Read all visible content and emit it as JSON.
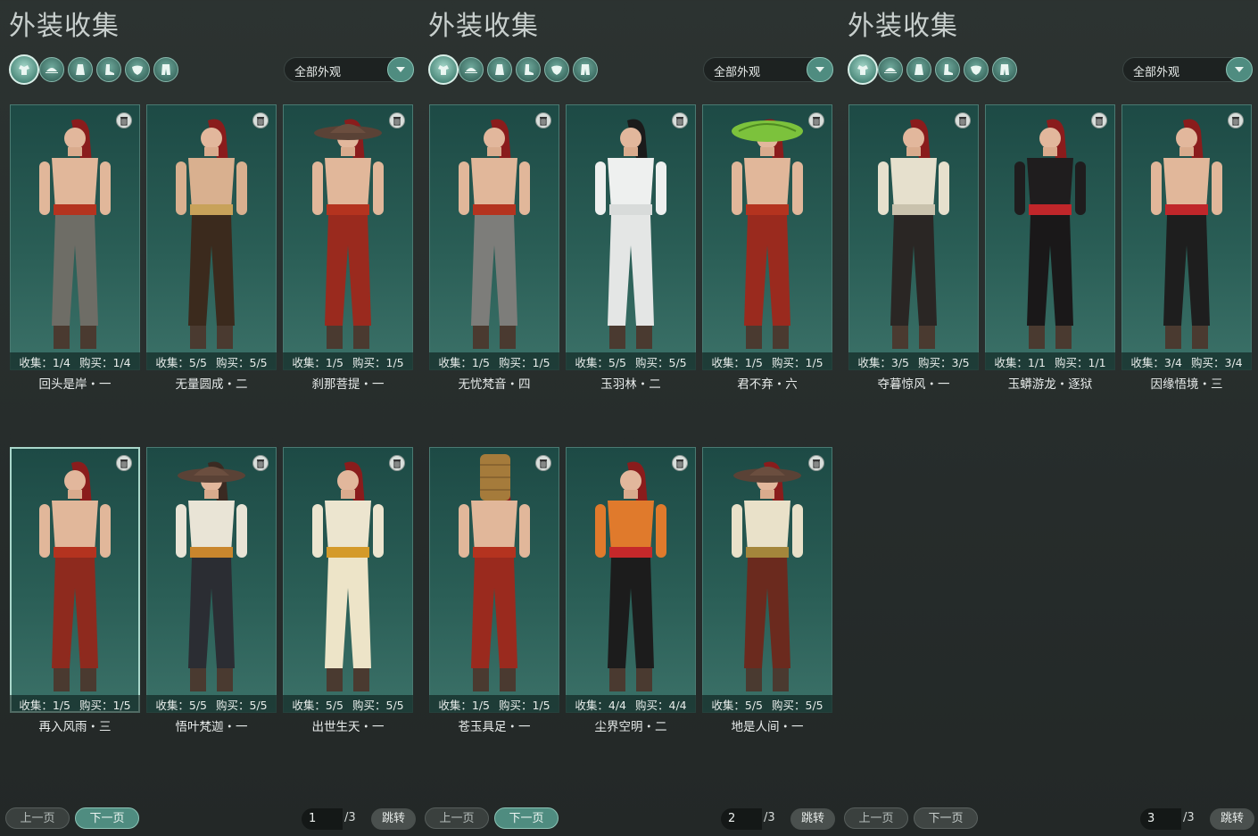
{
  "panels": [
    {
      "title": "外装收集",
      "filter_icons": [
        "outfit-icon",
        "hat-icon",
        "robe-icon",
        "boots-icon",
        "mask-icon",
        "pants-icon"
      ],
      "dropdown": {
        "label": "全部外观"
      },
      "cards": [
        {
          "collect_label": "收集：1/4",
          "buy_label": "购买：1/4",
          "name": "回头是岸・一",
          "hair": "#8a1c1c",
          "top": "#e1b79a",
          "pants": "#6e6d66",
          "sash": "#b4331f",
          "hat": "none"
        },
        {
          "collect_label": "收集：5/5",
          "buy_label": "购买：5/5",
          "name": "无量圆成・二",
          "hair": "#8a1c1c",
          "top": "#d9b08f",
          "pants": "#3b2a1d",
          "sash": "#c8a25a",
          "hat": "none"
        },
        {
          "collect_label": "收集：1/5",
          "buy_label": "购买：1/5",
          "name": "刹那菩提・一",
          "hair": "#8a1c1c",
          "top": "#e1b79a",
          "pants": "#9a2a1e",
          "sash": "#b4331f",
          "hat": "straw"
        },
        {
          "collect_label": "收集：1/5",
          "buy_label": "购买：1/5",
          "name": "再入风雨・三",
          "hair": "#8a1c1c",
          "top": "#e1b79a",
          "pants": "#8e2a1e",
          "sash": "#b4331f",
          "hat": "none",
          "selected": true
        },
        {
          "collect_label": "收集：5/5",
          "buy_label": "购买：5/5",
          "name": "悟叶梵迦・一",
          "hair": "#3a2a22",
          "top": "#e9e4d6",
          "pants": "#2b2d33",
          "sash": "#c9862d",
          "hat": "straw"
        },
        {
          "collect_label": "收集：5/5",
          "buy_label": "购买：5/5",
          "name": "出世生天・一",
          "hair": "#8a1c1c",
          "top": "#ece5cf",
          "pants": "#ede4c8",
          "sash": "#d49a2a",
          "hat": "none"
        }
      ],
      "pager": {
        "prev_label": "上一页",
        "next_label": "下一页",
        "page_value": "1",
        "page_total": "/3",
        "jump_label": "跳转"
      }
    },
    {
      "title": "外装收集",
      "filter_icons": [
        "outfit-icon",
        "hat-icon",
        "robe-icon",
        "boots-icon",
        "mask-icon",
        "pants-icon"
      ],
      "dropdown": {
        "label": "全部外观"
      },
      "cards": [
        {
          "collect_label": "收集：1/5",
          "buy_label": "购买：1/5",
          "name": "无忧梵音・四",
          "hair": "#8a1c1c",
          "top": "#e1b79a",
          "pants": "#7d7d7a",
          "sash": "#b4331f",
          "hat": "none"
        },
        {
          "collect_label": "收集：5/5",
          "buy_label": "购买：5/5",
          "name": "玉羽林・二",
          "hair": "#1b1b1b",
          "top": "#eef0ef",
          "pants": "#e4e6e5",
          "sash": "#d8dbda",
          "hat": "none"
        },
        {
          "collect_label": "收集：1/5",
          "buy_label": "购买：1/5",
          "name": "君不弃・六",
          "hair": "#8a1c1c",
          "top": "#e1b79a",
          "pants": "#9a2a1e",
          "sash": "#b4331f",
          "hat": "leaf"
        },
        {
          "collect_label": "收集：1/5",
          "buy_label": "购买：1/5",
          "name": "苍玉具足・一",
          "hair": "#8a1c1c",
          "top": "#e1b79a",
          "pants": "#9a2a1e",
          "sash": "#b4331f",
          "hat": "basket"
        },
        {
          "collect_label": "收集：4/4",
          "buy_label": "购买：4/4",
          "name": "尘界空明・二",
          "hair": "#8a1c1c",
          "top": "#e07a2c",
          "pants": "#1c1c1c",
          "sash": "#c5282a",
          "hat": "none"
        },
        {
          "collect_label": "收集：5/5",
          "buy_label": "购买：5/5",
          "name": "地是人间・一",
          "hair": "#8a1c1c",
          "top": "#e9e1c9",
          "pants": "#6b2a1e",
          "sash": "#a4863b",
          "hat": "straw"
        }
      ],
      "pager": {
        "prev_label": "上一页",
        "next_label": "下一页",
        "page_value": "2",
        "page_total": "/3",
        "jump_label": "跳转"
      }
    },
    {
      "title": "外装收集",
      "filter_icons": [
        "outfit-icon",
        "hat-icon",
        "robe-icon",
        "boots-icon",
        "mask-icon",
        "pants-icon"
      ],
      "dropdown": {
        "label": "全部外观"
      },
      "cards": [
        {
          "collect_label": "收集：3/5",
          "buy_label": "购买：3/5",
          "name": "夺暮惊风・一",
          "hair": "#8a1c1c",
          "top": "#e6e0cd",
          "pants": "#2a2624",
          "sash": "#c9c2ad",
          "hat": "none"
        },
        {
          "collect_label": "收集：1/1",
          "buy_label": "购买：1/1",
          "name": "玉蟒游龙・逐狱",
          "hair": "#8a1c1c",
          "top": "#1f1d1e",
          "pants": "#1a1819",
          "sash": "#c0262a",
          "hat": "none"
        },
        {
          "collect_label": "收集：3/4",
          "buy_label": "购买：3/4",
          "name": "因缘悟境・三",
          "hair": "#8a1c1c",
          "top": "#e1b79a",
          "pants": "#1e1e1e",
          "sash": "#c0262a",
          "hat": "none"
        }
      ],
      "pager": {
        "prev_label": "上一页",
        "next_label": "下一页",
        "page_value": "3",
        "page_total": "/3",
        "jump_label": "跳转"
      }
    }
  ]
}
